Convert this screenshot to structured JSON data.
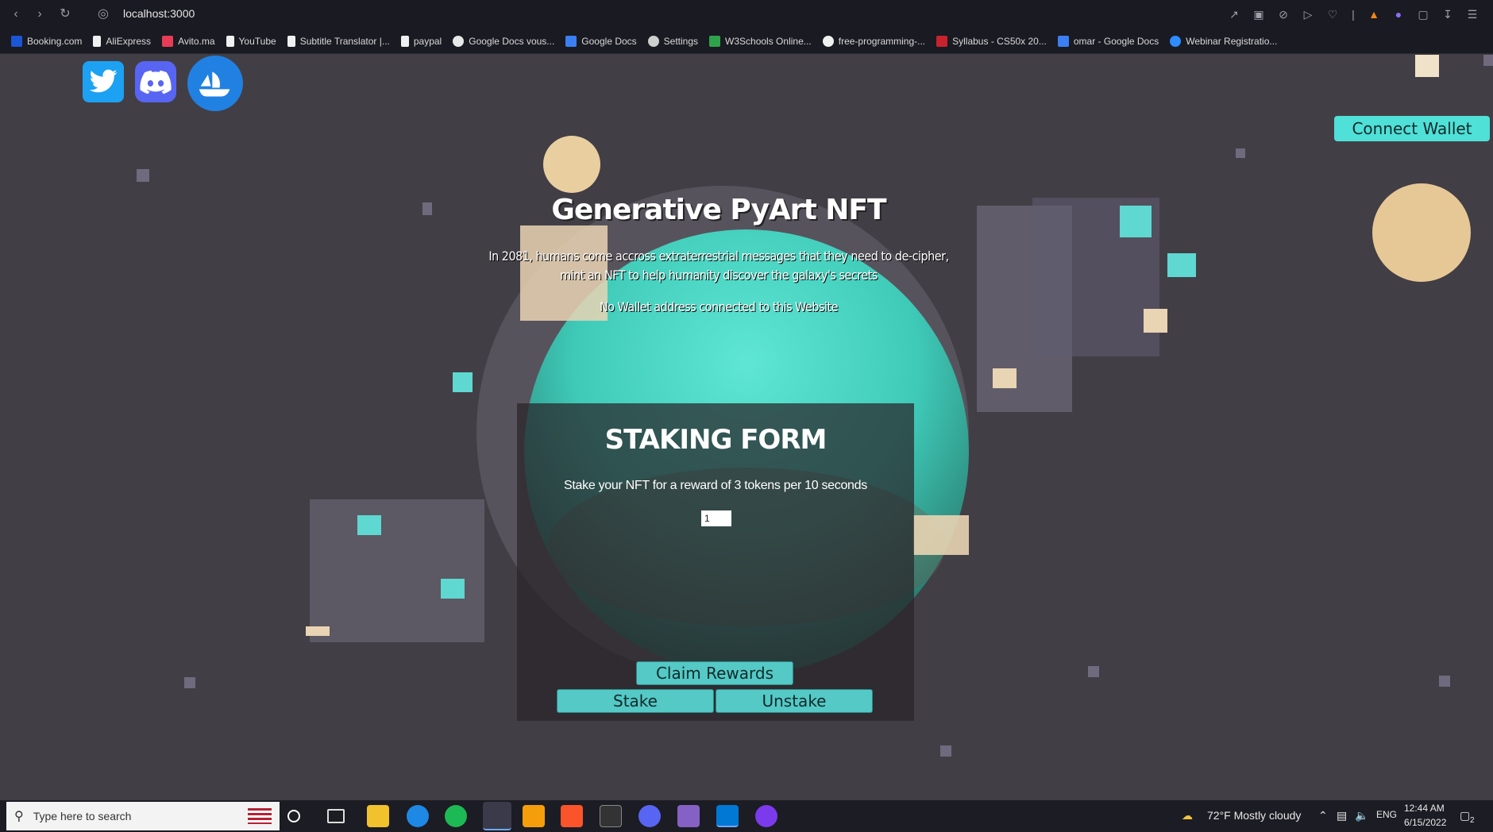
{
  "browser": {
    "url": "localhost:3000",
    "bookmarks": [
      {
        "label": "Booking.com",
        "color": "#1b56d4"
      },
      {
        "label": "AliExpress",
        "color": "#f0f0f0"
      },
      {
        "label": "Avito.ma",
        "color": "#e83b56"
      },
      {
        "label": "YouTube",
        "color": "#f0f0f0"
      },
      {
        "label": "Subtitle Translator |...",
        "color": "#f0f0f0"
      },
      {
        "label": "paypal",
        "color": "#f0f0f0"
      },
      {
        "label": "Google Docs vous...",
        "color": "#e8e8e8"
      },
      {
        "label": "Google Docs",
        "color": "#3b7ff2"
      },
      {
        "label": "Settings",
        "color": "#cfcfcf"
      },
      {
        "label": "W3Schools Online...",
        "color": "#2ea34a"
      },
      {
        "label": "free-programming-...",
        "color": "#f0f0f0"
      },
      {
        "label": "Syllabus - CS50x 20...",
        "color": "#c8232c"
      },
      {
        "label": "omar - Google Docs",
        "color": "#3b7ff2"
      },
      {
        "label": "Webinar Registratio...",
        "color": "#2d8cff"
      }
    ]
  },
  "header": {
    "connect_wallet_label": "Connect Wallet"
  },
  "hero": {
    "title": "Generative PyArt NFT",
    "line1": "In 2081, humans come accross extraterrestrial messages that they need to de-cipher,",
    "line2": "mint an NFT to help humanity discover the galaxy's secrets",
    "wallet_status": "No Wallet address connected to this Website"
  },
  "staking_form": {
    "title": "STAKING FORM",
    "description": "Stake your NFT for a reward of 3 tokens per 10 seconds",
    "input_value": "1",
    "claim_label": "Claim Rewards",
    "stake_label": "Stake",
    "unstake_label": "Unstake"
  },
  "taskbar": {
    "search_placeholder": "Type here to search",
    "weather": "72°F  Mostly cloudy",
    "language": "ENG",
    "time": "12:44 AM",
    "date": "6/15/2022",
    "notification_count": "2"
  },
  "colors": {
    "accent": "#4fe0d8",
    "page_bg": "#423e45",
    "chrome_bg": "#1a1a22"
  }
}
